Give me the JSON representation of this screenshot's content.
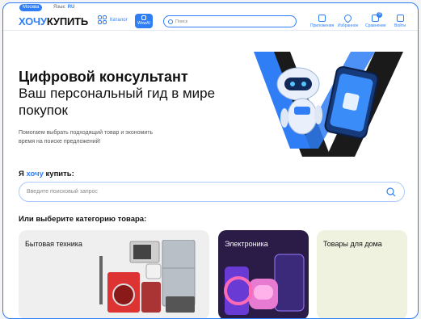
{
  "topbar": {
    "city": "Москва",
    "lang_label": "Язык:",
    "lang_value": "RU"
  },
  "logo": {
    "part1": "ХОЧУ",
    "part2": "КУПИТЬ"
  },
  "header": {
    "catalog_label": "Каталог",
    "wowai_label": "WowAI",
    "search_placeholder": "Поиск",
    "nav": [
      {
        "label": "Приложения",
        "icon": "apps-icon"
      },
      {
        "label": "Избранное",
        "icon": "heart-icon"
      },
      {
        "label": "Сравнение",
        "icon": "compare-icon",
        "badge": "0"
      },
      {
        "label": "Войти",
        "icon": "login-icon"
      }
    ]
  },
  "hero": {
    "title": "Цифровой консультант",
    "subtitle": "Ваш персональный гид в мире покупок",
    "text": "Помогаем выбрать подходящий товар и экономить время на поиске предложений!"
  },
  "search": {
    "label_prefix": "Я",
    "label_highlight": "хочу",
    "label_suffix": "купить:",
    "placeholder": "Введите поисковый запрос"
  },
  "categories": {
    "title": "Или выберите категорию товара:",
    "items": [
      {
        "label": "Бытовая техника"
      },
      {
        "label": "Электроника"
      },
      {
        "label": "Товары для дома"
      }
    ]
  },
  "colors": {
    "accent": "#2f7ef5",
    "dark_card": "#2a1b47",
    "light_card": "#eef2de"
  }
}
